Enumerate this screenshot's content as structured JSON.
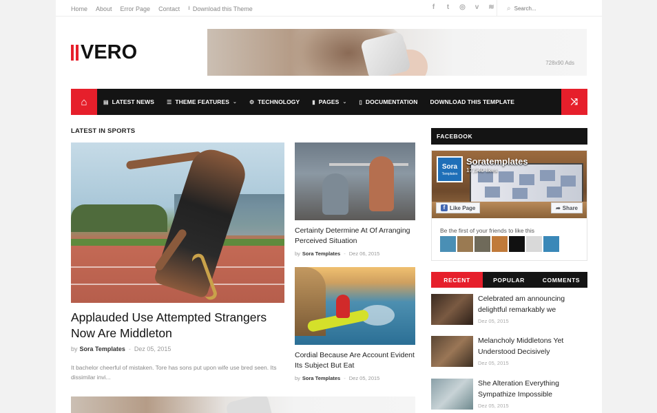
{
  "topbar": {
    "links": [
      "Home",
      "About",
      "Error Page",
      "Contact"
    ],
    "download_label": "Download this Theme",
    "social": [
      "facebook",
      "twitter",
      "dribbble",
      "vimeo",
      "rss"
    ],
    "search_placeholder": "Search..."
  },
  "logo": {
    "text": "VERO"
  },
  "ad": {
    "label": "728x90 Ads"
  },
  "nav": {
    "items": [
      {
        "label": "LATEST NEWS",
        "icon": "newspaper-icon",
        "dropdown": false
      },
      {
        "label": "THEME FEATURES",
        "icon": "list-icon",
        "dropdown": true
      },
      {
        "label": "TECHNOLOGY",
        "icon": "gears-icon",
        "dropdown": false
      },
      {
        "label": "PAGES",
        "icon": "bookmark-icon",
        "dropdown": true
      },
      {
        "label": "DOCUMENTATION",
        "icon": "file-icon",
        "dropdown": false
      },
      {
        "label": "DOWNLOAD THIS TEMPLATE",
        "icon": "",
        "dropdown": false
      }
    ]
  },
  "section": {
    "title": "LATEST IN SPORTS"
  },
  "featured": {
    "title": "Applauded Use Attempted Strangers Now Are Middleton",
    "by": "by",
    "author": "Sora Templates",
    "date": "Dez 05, 2015",
    "excerpt": "It bachelor cheerful of mistaken. Tore has sons put upon wife use bred seen. Its dissimilar invi..."
  },
  "posts": [
    {
      "title": "Certainty Determine At Of Arranging Perceived Situation",
      "by": "by",
      "author": "Sora Templates",
      "date": "Dez 06, 2015"
    },
    {
      "title": "Cordial Because Are Account Evident Its Subject But Eat",
      "by": "by",
      "author": "Sora Templates",
      "date": "Dez 05, 2015"
    }
  ],
  "sidebar": {
    "facebook": {
      "title": "FACEBOOK",
      "page_name": "Soratemplates",
      "likes": "17,540 likes",
      "logo_text": "Sora",
      "logo_sub": "Templates",
      "like_label": "Like Page",
      "share_label": "Share",
      "friends_text": "Be the first of your friends to like this"
    },
    "tabs": [
      "RECENT",
      "POPULAR",
      "COMMENTS"
    ],
    "recent": [
      {
        "title": "Celebrated am announcing delightful remarkably we",
        "date": "Dez 05, 2015"
      },
      {
        "title": "Melancholy Middletons Yet Understood Decisively",
        "date": "Dez 05, 2015"
      },
      {
        "title": "She Alteration Everything Sympathize Impossible",
        "date": "Dez 05, 2015"
      }
    ]
  },
  "colors": {
    "accent": "#e61f2b",
    "nav_bg": "#141414"
  }
}
